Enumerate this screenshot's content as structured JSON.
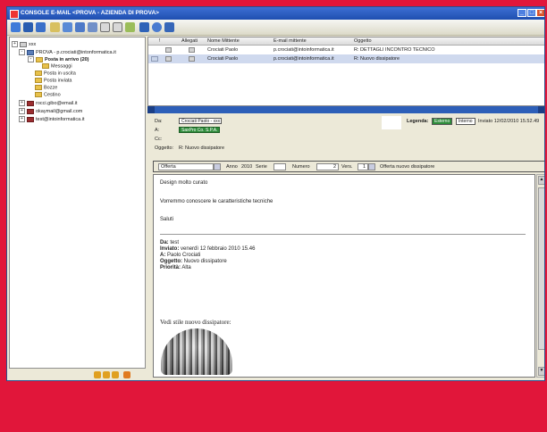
{
  "window": {
    "title": "CONSOLE E-MAIL <PROVA - AZIENDA DI PROVA>"
  },
  "tree": [
    {
      "label": "xxx",
      "expander": "+"
    },
    {
      "label": "PROVA - p.crociati@intonformatica.it",
      "expander": "-"
    },
    {
      "label": "Posta in arrivo (20)",
      "expander": "-"
    },
    {
      "label": "Messaggi",
      "expander": ""
    },
    {
      "label": "Posta in uscita",
      "expander": ""
    },
    {
      "label": "Posta inviata",
      "expander": ""
    },
    {
      "label": "Bozze",
      "expander": ""
    },
    {
      "label": "Cestino",
      "expander": ""
    },
    {
      "label": "rocci.gibo@email.it",
      "expander": "+"
    },
    {
      "label": "okaymail@gmail.com",
      "expander": "+"
    },
    {
      "label": "test@intoinformatica.it",
      "expander": "+"
    }
  ],
  "list": {
    "columns": [
      "!",
      "Allegati",
      "Nome Mittente",
      "E-mail mittente",
      "Oggetto"
    ],
    "rows": [
      {
        "name": "Crociati Paolo",
        "email": "p.crociati@intoinformatica.it",
        "subject": "R: DETTAGLI INCONTRO TECNICO"
      },
      {
        "name": "Crociati Paolo",
        "email": "p.crociati@intoinformatica.it",
        "subject": "R: Nuovo dissipatore"
      }
    ]
  },
  "header": {
    "da_label": "Da:",
    "da_value": "Crociati Paolo - xxx",
    "a_label": "A:",
    "a_value": "SaxPro Co. S.P.A.",
    "cc_label": "Cc:",
    "oggetto_label": "Oggetto:",
    "oggetto_value": "R: Nuovo dissipatore",
    "legenda_label": "Legenda:",
    "legend_esterno": "Esterno",
    "legend_interno": "Interno",
    "inviato": "Inviato 12/02/2010 15.52.49"
  },
  "offerta": {
    "type": "Offerta",
    "anno_label": "Anno",
    "anno": "2010",
    "serie_label": "Serie",
    "numero_label": "Numero",
    "numero": "2",
    "vers_label": "Vers.",
    "vers": "1",
    "description": "Offerta nuovo dissipatore"
  },
  "body": {
    "lines": [
      "Design molto  curato",
      "Vorremmo conoscere le caratteristiche tecniche",
      "Saluti"
    ],
    "quoted": [
      {
        "label": "Da:",
        "value": "test"
      },
      {
        "label": "Inviato:",
        "value": "venerdì 12 febbraio 2010 15.46"
      },
      {
        "label": "A:",
        "value": "Paolo Crociati"
      },
      {
        "label": "Oggetto:",
        "value": "Nuovo dissipatore"
      },
      {
        "label": "Priorità:",
        "value": "Alta"
      }
    ],
    "image_caption": "Vedi stile nuovo dissipatore:"
  },
  "colors": {
    "frame": "#e1163a",
    "titlebar": "#2456c4",
    "green_badge": "#2e8b3a"
  }
}
